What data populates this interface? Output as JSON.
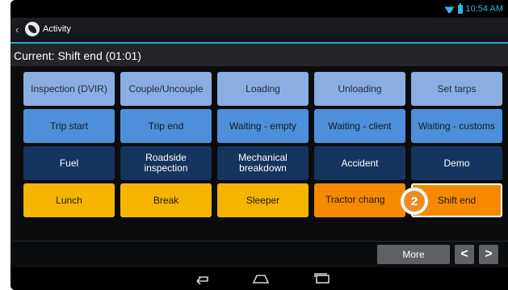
{
  "status": {
    "time": "10:54 AM"
  },
  "actionbar": {
    "title": "Activity"
  },
  "current": {
    "text": "Current: Shift end (01:01)"
  },
  "buttons": [
    {
      "label": "Inspection (DVIR)",
      "style": "light"
    },
    {
      "label": "Couple/Uncouple",
      "style": "light"
    },
    {
      "label": "Loading",
      "style": "light"
    },
    {
      "label": "Unloading",
      "style": "light"
    },
    {
      "label": "Set tarps",
      "style": "light"
    },
    {
      "label": "Trip start",
      "style": "mid"
    },
    {
      "label": "Trip end",
      "style": "mid"
    },
    {
      "label": "Waiting - empty",
      "style": "mid"
    },
    {
      "label": "Waiting - client",
      "style": "mid"
    },
    {
      "label": "Waiting - customs",
      "style": "mid"
    },
    {
      "label": "Fuel",
      "style": "dark"
    },
    {
      "label": "Roadside inspection",
      "style": "dark"
    },
    {
      "label": "Mechanical breakdown",
      "style": "dark"
    },
    {
      "label": "Accident",
      "style": "dark"
    },
    {
      "label": "Demo",
      "style": "dark"
    },
    {
      "label": "Lunch",
      "style": "yellow"
    },
    {
      "label": "Break",
      "style": "yellow"
    },
    {
      "label": "Sleeper",
      "style": "yellow"
    },
    {
      "label": "Tractor chang",
      "style": "orange"
    },
    {
      "label": "Shift end",
      "style": "selected"
    }
  ],
  "callout": {
    "number": "2"
  },
  "bottom": {
    "more_label": "More",
    "prev_glyph": "<",
    "next_glyph": ">"
  },
  "colors": {
    "accent": "#2aa7c9",
    "light_blue": "#8aaee2",
    "mid_blue": "#4d8fd9",
    "dark_blue": "#15345e",
    "yellow": "#f5b400",
    "orange": "#f58a00"
  }
}
